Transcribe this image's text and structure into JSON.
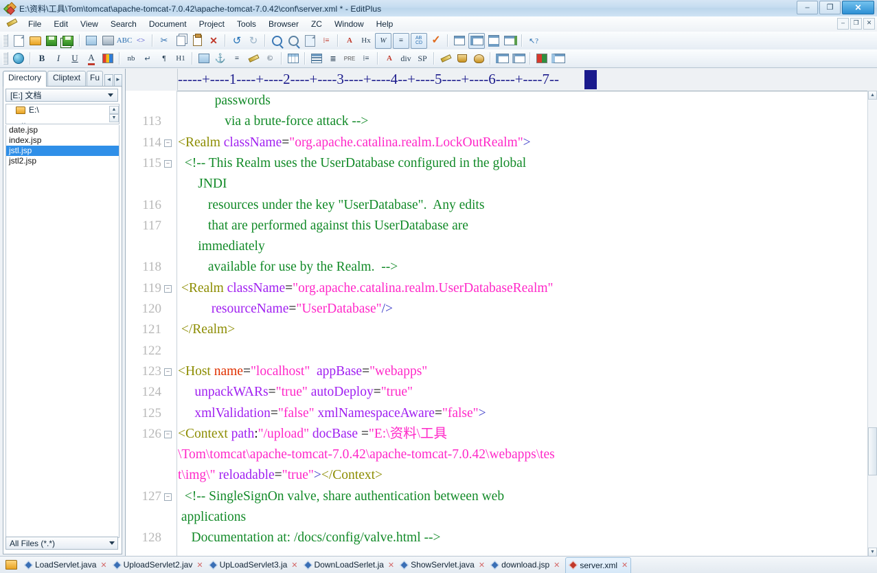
{
  "window": {
    "title": "E:\\资料\\工具\\Tom\\tomcat\\apache-tomcat-7.0.42\\apache-tomcat-7.0.42\\conf\\server.xml * - EditPlus",
    "icon": "editplus-icon",
    "controls": {
      "minimize": "–",
      "maximize": "❐",
      "close": "✕"
    }
  },
  "menubar": {
    "items": [
      "File",
      "Edit",
      "View",
      "Search",
      "Document",
      "Project",
      "Tools",
      "Browser",
      "ZC",
      "Window",
      "Help"
    ],
    "doc_controls": [
      "–",
      "❐",
      "✕"
    ]
  },
  "toolbar_row1": [
    {
      "name": "new-file",
      "glyph": ""
    },
    {
      "name": "open-file",
      "glyph": ""
    },
    {
      "name": "save-file",
      "glyph": ""
    },
    {
      "name": "save-all",
      "glyph": ""
    },
    {
      "name": "page-setup",
      "glyph": ""
    },
    {
      "name": "print",
      "glyph": ""
    },
    {
      "name": "spell-check",
      "glyph": "ABC"
    },
    {
      "name": "view-source",
      "glyph": "<>"
    },
    {
      "name": "cut",
      "glyph": "✂"
    },
    {
      "name": "copy",
      "glyph": ""
    },
    {
      "name": "paste",
      "glyph": ""
    },
    {
      "name": "delete",
      "glyph": "✕"
    },
    {
      "name": "undo",
      "glyph": "↺"
    },
    {
      "name": "redo",
      "glyph": "↻"
    },
    {
      "name": "find",
      "glyph": ""
    },
    {
      "name": "replace",
      "glyph": ""
    },
    {
      "name": "find-in-files",
      "glyph": ""
    },
    {
      "name": "goto-line",
      "glyph": ""
    },
    {
      "name": "font-size",
      "glyph": "A"
    },
    {
      "name": "hex-view",
      "glyph": "Hx"
    },
    {
      "name": "word-wrap",
      "glyph": "W"
    },
    {
      "name": "line-numbers",
      "glyph": ""
    },
    {
      "name": "show-spaces",
      "glyph": "AB"
    },
    {
      "name": "validate",
      "glyph": "✓"
    },
    {
      "name": "clip-window",
      "glyph": ""
    },
    {
      "name": "directory-window",
      "glyph": ""
    },
    {
      "name": "output-window",
      "glyph": ""
    },
    {
      "name": "browser-preview",
      "glyph": ""
    },
    {
      "name": "context-help",
      "glyph": "?"
    }
  ],
  "toolbar_row2": [
    {
      "name": "browser",
      "glyph": ""
    },
    {
      "name": "bold",
      "glyph": "B"
    },
    {
      "name": "italic",
      "glyph": "I"
    },
    {
      "name": "underline",
      "glyph": "U"
    },
    {
      "name": "font-color",
      "glyph": "A"
    },
    {
      "name": "color-picker",
      "glyph": ""
    },
    {
      "name": "nbsp",
      "glyph": "nb"
    },
    {
      "name": "line-break",
      "glyph": "↵"
    },
    {
      "name": "paragraph",
      "glyph": "¶"
    },
    {
      "name": "heading",
      "glyph": "H1"
    },
    {
      "name": "insert-image",
      "glyph": ""
    },
    {
      "name": "anchor",
      "glyph": "⚓"
    },
    {
      "name": "horizontal-rule",
      "glyph": "≡"
    },
    {
      "name": "highlight",
      "glyph": ""
    },
    {
      "name": "copyright",
      "glyph": "©"
    },
    {
      "name": "insert-table",
      "glyph": ""
    },
    {
      "name": "align-left",
      "glyph": ""
    },
    {
      "name": "align-center",
      "glyph": ""
    },
    {
      "name": "preformatted",
      "glyph": "PRE"
    },
    {
      "name": "list",
      "glyph": ""
    },
    {
      "name": "font-tag",
      "glyph": "A"
    },
    {
      "name": "div-tag",
      "glyph": "div"
    },
    {
      "name": "span-tag",
      "glyph": "SP"
    },
    {
      "name": "edit-tag",
      "glyph": ""
    },
    {
      "name": "java-tool",
      "glyph": ""
    },
    {
      "name": "palette",
      "glyph": ""
    },
    {
      "name": "form-field",
      "glyph": ""
    },
    {
      "name": "form-list",
      "glyph": ""
    },
    {
      "name": "color-chart",
      "glyph": ""
    },
    {
      "name": "frame",
      "glyph": ""
    }
  ],
  "sidebar": {
    "tabs": [
      {
        "label": "Directory",
        "active": true
      },
      {
        "label": "Cliptext",
        "active": false
      },
      {
        "label": "Fu",
        "active": false
      }
    ],
    "nav_prev": "◄",
    "nav_next": "►",
    "drive_selector": "[E:] 文档",
    "tree_root": "E:\\",
    "tree_parent": "..",
    "files": [
      {
        "name": "date.jsp",
        "selected": false
      },
      {
        "name": "index.jsp",
        "selected": false
      },
      {
        "name": "jstl.jsp",
        "selected": true
      },
      {
        "name": "jstl2.jsp",
        "selected": false
      }
    ],
    "filter": "All Files (*.*)"
  },
  "editor": {
    "ruler": "-----+----1----+----2----+----3----+----4--+----5----+----6----+----7--",
    "cursor_column_marker": true,
    "lines": [
      {
        "num": "",
        "fold": false,
        "indent": 11,
        "segs": [
          {
            "t": "passwords",
            "c": "k-cmt"
          }
        ]
      },
      {
        "num": "113",
        "fold": false,
        "indent": 14,
        "segs": [
          {
            "t": "via a brute-force attack -->",
            "c": "k-cmt"
          }
        ]
      },
      {
        "num": "114",
        "fold": true,
        "indent": 0,
        "segs": [
          {
            "t": "<Realm",
            "c": "k-tag"
          },
          {
            "t": " ",
            "c": "k-txt"
          },
          {
            "t": "className",
            "c": "k-attr"
          },
          {
            "t": "=",
            "c": "k-txt"
          },
          {
            "t": "\"org.apache.catalina.realm.LockOutRealm\"",
            "c": "k-str"
          },
          {
            "t": ">",
            "c": "k-br"
          }
        ]
      },
      {
        "num": "115",
        "fold": true,
        "indent": 2,
        "segs": [
          {
            "t": "<!-- This Realm uses the UserDatabase configured in the global",
            "c": "k-cmt"
          }
        ]
      },
      {
        "num": "",
        "fold": false,
        "indent": 6,
        "segs": [
          {
            "t": "JNDI",
            "c": "k-cmt"
          }
        ]
      },
      {
        "num": "116",
        "fold": false,
        "indent": 9,
        "segs": [
          {
            "t": "resources under the key \"UserDatabase\".  Any edits",
            "c": "k-cmt"
          }
        ]
      },
      {
        "num": "117",
        "fold": false,
        "indent": 9,
        "segs": [
          {
            "t": "that are performed against this UserDatabase are",
            "c": "k-cmt"
          }
        ]
      },
      {
        "num": "",
        "fold": false,
        "indent": 6,
        "segs": [
          {
            "t": "immediately",
            "c": "k-cmt"
          }
        ]
      },
      {
        "num": "118",
        "fold": false,
        "indent": 9,
        "segs": [
          {
            "t": "available for use by the Realm.  -->",
            "c": "k-cmt"
          }
        ]
      },
      {
        "num": "119",
        "fold": true,
        "indent": 1,
        "segs": [
          {
            "t": "<Realm",
            "c": "k-tag"
          },
          {
            "t": " ",
            "c": "k-txt"
          },
          {
            "t": "className",
            "c": "k-attr"
          },
          {
            "t": "=",
            "c": "k-txt"
          },
          {
            "t": "\"org.apache.catalina.realm.UserDatabaseRealm\"",
            "c": "k-str"
          }
        ]
      },
      {
        "num": "120",
        "fold": false,
        "indent": 10,
        "segs": [
          {
            "t": "resourceName",
            "c": "k-attr"
          },
          {
            "t": "=",
            "c": "k-txt"
          },
          {
            "t": "\"UserDatabase\"",
            "c": "k-str"
          },
          {
            "t": "/>",
            "c": "k-br"
          }
        ]
      },
      {
        "num": "121",
        "fold": false,
        "indent": 1,
        "segs": [
          {
            "t": "</Realm>",
            "c": "k-tag"
          }
        ]
      },
      {
        "num": "122",
        "fold": false,
        "indent": 0,
        "segs": []
      },
      {
        "num": "123",
        "fold": true,
        "indent": 0,
        "segs": [
          {
            "t": "<Host",
            "c": "k-tag"
          },
          {
            "t": " ",
            "c": "k-txt"
          },
          {
            "t": "name",
            "c": "k-attr2"
          },
          {
            "t": "=",
            "c": "k-txt"
          },
          {
            "t": "\"localhost\"",
            "c": "k-str"
          },
          {
            "t": "  ",
            "c": "k-txt"
          },
          {
            "t": "appBase",
            "c": "k-attr"
          },
          {
            "t": "=",
            "c": "k-txt"
          },
          {
            "t": "\"webapps\"",
            "c": "k-str"
          }
        ]
      },
      {
        "num": "124",
        "fold": false,
        "indent": 5,
        "segs": [
          {
            "t": "unpackWARs",
            "c": "k-attr"
          },
          {
            "t": "=",
            "c": "k-txt"
          },
          {
            "t": "\"true\"",
            "c": "k-str"
          },
          {
            "t": " ",
            "c": "k-txt"
          },
          {
            "t": "autoDeploy",
            "c": "k-attr"
          },
          {
            "t": "=",
            "c": "k-txt"
          },
          {
            "t": "\"true\"",
            "c": "k-str"
          }
        ]
      },
      {
        "num": "125",
        "fold": false,
        "indent": 5,
        "segs": [
          {
            "t": "xmlValidation",
            "c": "k-attr"
          },
          {
            "t": "=",
            "c": "k-txt"
          },
          {
            "t": "\"false\"",
            "c": "k-str"
          },
          {
            "t": " ",
            "c": "k-txt"
          },
          {
            "t": "xmlNamespaceAware",
            "c": "k-attr"
          },
          {
            "t": "=",
            "c": "k-txt"
          },
          {
            "t": "\"false\"",
            "c": "k-str"
          },
          {
            "t": ">",
            "c": "k-br"
          }
        ]
      },
      {
        "num": "126",
        "fold": true,
        "indent": 0,
        "segs": [
          {
            "t": "<Context",
            "c": "k-tag"
          },
          {
            "t": " ",
            "c": "k-txt"
          },
          {
            "t": "path",
            "c": "k-attr"
          },
          {
            "t": ":",
            "c": "k-txt"
          },
          {
            "t": "\"/upload\"",
            "c": "k-str"
          },
          {
            "t": " ",
            "c": "k-txt"
          },
          {
            "t": "docBase",
            "c": "k-attr"
          },
          {
            "t": " =",
            "c": "k-txt"
          },
          {
            "t": "\"E:\\资料\\工具",
            "c": "k-str"
          }
        ]
      },
      {
        "num": "",
        "fold": false,
        "indent": 0,
        "segs": [
          {
            "t": "\\Tom\\tomcat\\apache-tomcat-7.0.42\\apache-tomcat-7.0.42\\webapps\\tes",
            "c": "k-str"
          }
        ]
      },
      {
        "num": "",
        "fold": false,
        "indent": 0,
        "segs": [
          {
            "t": "t\\img\\\"",
            "c": "k-str"
          },
          {
            "t": " ",
            "c": "k-txt"
          },
          {
            "t": "reloadable",
            "c": "k-attr"
          },
          {
            "t": "=",
            "c": "k-txt"
          },
          {
            "t": "\"true\"",
            "c": "k-str"
          },
          {
            "t": ">",
            "c": "k-br"
          },
          {
            "t": "</Context>",
            "c": "k-tag"
          }
        ]
      },
      {
        "num": "127",
        "fold": true,
        "indent": 2,
        "segs": [
          {
            "t": "<!-- SingleSignOn valve, share authentication between web",
            "c": "k-cmt"
          }
        ]
      },
      {
        "num": "",
        "fold": false,
        "indent": 1,
        "segs": [
          {
            "t": "applications",
            "c": "k-cmt"
          }
        ]
      },
      {
        "num": "128",
        "fold": false,
        "indent": 4,
        "segs": [
          {
            "t": "Documentation at: /docs/config/valve.html -->",
            "c": "k-cmt"
          }
        ]
      }
    ]
  },
  "filetabs": [
    {
      "label": "LoadServlet.java",
      "active": false,
      "icon": "blue-diamond"
    },
    {
      "label": "UploadServlet2.jav",
      "active": false,
      "icon": "blue-diamond"
    },
    {
      "label": "UpLoadServlet3.ja",
      "active": false,
      "icon": "blue-diamond"
    },
    {
      "label": "DownLoadSerlet.ja",
      "active": false,
      "icon": "blue-diamond"
    },
    {
      "label": "ShowServlet.java",
      "active": false,
      "icon": "blue-diamond"
    },
    {
      "label": "download.jsp",
      "active": false,
      "icon": "blue-diamond"
    },
    {
      "label": "server.xml",
      "active": true,
      "icon": "red-diamond"
    }
  ],
  "colors": {
    "tag": "#8c8c00",
    "attribute": "#a020f0",
    "attribute_alt": "#e03000",
    "string": "#ff28c8",
    "comment": "#128a28",
    "bracket": "#3838c8",
    "selection": "#2f8fe8",
    "ruler": "#1c1c8c",
    "line_number": "#b8b8b8"
  }
}
